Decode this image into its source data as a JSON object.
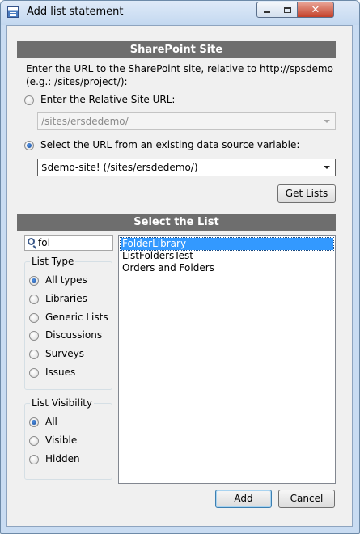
{
  "window": {
    "title": "Add list statement",
    "close_glyph": "✕"
  },
  "sharepoint_site": {
    "header": "SharePoint Site",
    "description": "Enter the URL to the SharePoint site, relative to http://spsdemo (e.g.: /sites/project/):",
    "relative_option_label": "Enter the Relative Site URL:",
    "relative_url_value": "/sites/ersdedemo/",
    "variable_option_label": "Select the URL from an existing data source variable:",
    "variable_value": "$demo-site! (/sites/ersdedemo/)",
    "get_lists_label": "Get Lists"
  },
  "select_list": {
    "header": "Select the List",
    "search_value": "fol",
    "list_type": {
      "legend": "List Type",
      "options": [
        "All types",
        "Libraries",
        "Generic Lists",
        "Discussions",
        "Surveys",
        "Issues"
      ],
      "selected": "All types"
    },
    "list_visibility": {
      "legend": "List Visibility",
      "options": [
        "All",
        "Visible",
        "Hidden"
      ],
      "selected": "All"
    },
    "lists": [
      "FolderLibrary",
      "ListFoldersTest",
      "Orders and Folders"
    ],
    "selected_list": "FolderLibrary"
  },
  "footer": {
    "add_label": "Add",
    "cancel_label": "Cancel"
  },
  "colors": {
    "section_header_bg": "#6e6e6e",
    "selection_blue": "#3399ff",
    "window_frame": "#c9dcf2"
  }
}
